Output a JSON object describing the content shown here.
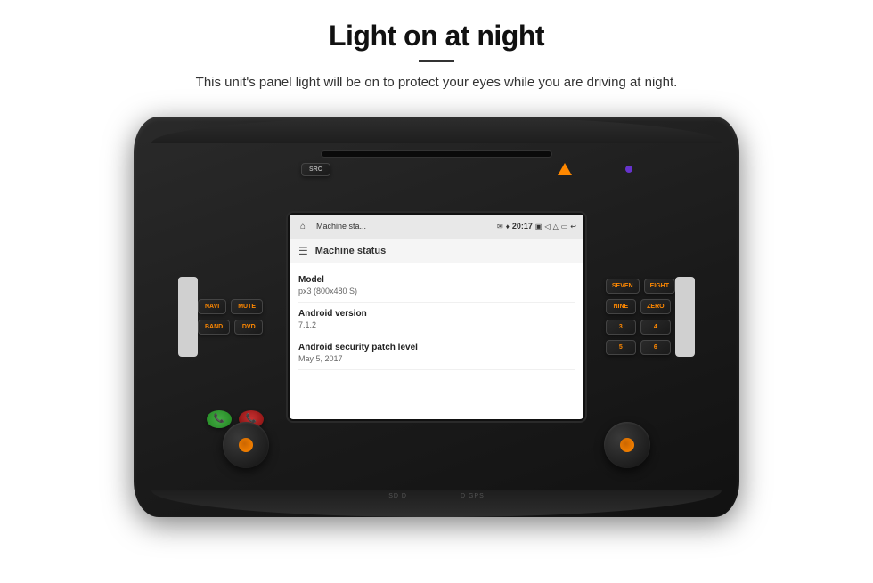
{
  "header": {
    "title": "Light on at night",
    "subtitle": "This unit's panel light will be on to protect your eyes while you are driving at night."
  },
  "android_screen": {
    "status_bar": {
      "app_title": "Machine sta...",
      "time": "20:17"
    },
    "app": {
      "menu_title": "Machine status",
      "rows": [
        {
          "label": "Model",
          "value": "px3 (800x480 S)"
        },
        {
          "label": "Android version",
          "value": "7.1.2"
        },
        {
          "label": "Android security patch level",
          "value": "May 5, 2017"
        }
      ]
    }
  },
  "buttons": {
    "left": [
      {
        "label": "NAVI"
      },
      {
        "label": "MUTE"
      },
      {
        "label": "BAND"
      },
      {
        "label": "DVD"
      }
    ],
    "right": [
      {
        "label": "SEVEN"
      },
      {
        "label": "EIGHT"
      },
      {
        "label": "NINE"
      },
      {
        "label": "ZERO"
      }
    ],
    "top_left": "SRC"
  },
  "bottom_labels": [
    "SD  D",
    "D  GPS"
  ],
  "icons": {
    "home": "⌂",
    "menu": "☰",
    "phone_answer": "📞",
    "phone_decline": "📞"
  }
}
